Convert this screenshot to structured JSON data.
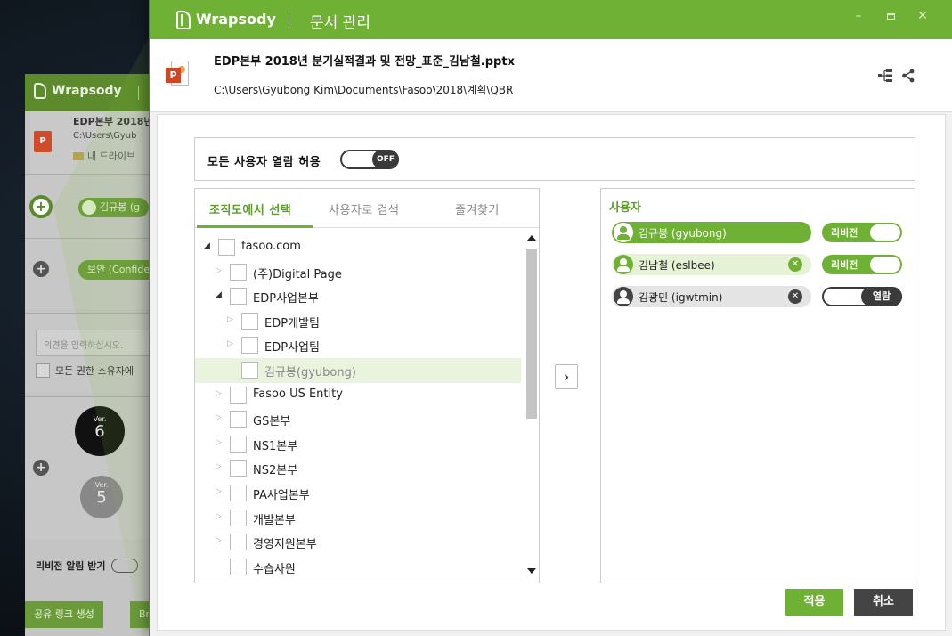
{
  "background_window": {
    "brand": "Wrapsody",
    "file_name": "EDP본부 2018년",
    "file_path": "C:\\Users\\Gyub",
    "folder": "내 드라이브",
    "chip_owner": "김규봉 (g",
    "chip_security": "보안 (Confide",
    "comment_placeholder": "의견을 입력하십시오.",
    "checkbox_label": "모든 권한 소유자에",
    "version_label": "Ver.",
    "version_6": "6",
    "version_5": "5",
    "revision_alert": "리비전 알림 받기",
    "share_link_button": "공유 링크 생성",
    "bra_button": "Bra"
  },
  "window": {
    "brand": "Wrapsody",
    "title": "문서 관리",
    "minimize": "–",
    "close": "✕"
  },
  "file": {
    "icon_letter": "P",
    "name": "EDP본부 2018년 분기실적결과 및 전망_표준_김남철.pptx",
    "path": "C:\\Users\\Gyubong Kim\\Documents\\Fasoo\\2018\\계획\\QBR"
  },
  "allow_all": {
    "label": "모든 사용자 열람 허용",
    "toggle_state": "OFF"
  },
  "tabs": [
    {
      "label": "조직도에서 선택",
      "active": true
    },
    {
      "label": "사용자로 검색",
      "active": false
    },
    {
      "label": "즐겨찾기",
      "active": false
    }
  ],
  "tree": [
    {
      "label": "fasoo.com",
      "depth": 0,
      "arrow": "◢",
      "open": true,
      "selected": false
    },
    {
      "label": "(주)Digital Page",
      "depth": 1,
      "arrow": "▷",
      "open": false,
      "selected": false
    },
    {
      "label": "EDP사업본부",
      "depth": 1,
      "arrow": "◢",
      "open": true,
      "selected": false
    },
    {
      "label": "EDP개발팀",
      "depth": 2,
      "arrow": "▷",
      "open": false,
      "selected": false
    },
    {
      "label": "EDP사업팀",
      "depth": 2,
      "arrow": "▷",
      "open": false,
      "selected": false
    },
    {
      "label": "김규봉(gyubong)",
      "depth": 2,
      "arrow": "",
      "open": false,
      "selected": true
    },
    {
      "label": "Fasoo US Entity",
      "depth": 1,
      "arrow": "▷",
      "open": false,
      "selected": false
    },
    {
      "label": "GS본부",
      "depth": 1,
      "arrow": "▷",
      "open": false,
      "selected": false
    },
    {
      "label": "NS1본부",
      "depth": 1,
      "arrow": "▷",
      "open": false,
      "selected": false
    },
    {
      "label": "NS2본부",
      "depth": 1,
      "arrow": "▷",
      "open": false,
      "selected": false
    },
    {
      "label": "PA사업본부",
      "depth": 1,
      "arrow": "▷",
      "open": false,
      "selected": false
    },
    {
      "label": "개발본부",
      "depth": 1,
      "arrow": "▷",
      "open": false,
      "selected": false
    },
    {
      "label": "경영지원본부",
      "depth": 1,
      "arrow": "▷",
      "open": false,
      "selected": false
    },
    {
      "label": "수습사원",
      "depth": 1,
      "arrow": "",
      "open": false,
      "selected": false
    }
  ],
  "move_button": "›",
  "users_panel": {
    "title": "사용자",
    "users": [
      {
        "name": "김규봉 (gyubong)",
        "style": "owner",
        "removable": false,
        "permission": "리비전",
        "perm_style": "green"
      },
      {
        "name": "김남철 (eslbee)",
        "style": "light",
        "removable": true,
        "permission": "리비전",
        "perm_style": "green"
      },
      {
        "name": "김광민 (igwtmin)",
        "style": "grey",
        "removable": true,
        "permission": "열람",
        "perm_style": "dark"
      }
    ],
    "remove_glyph": "✕"
  },
  "buttons": {
    "apply": "적용",
    "cancel": "취소"
  },
  "colors": {
    "accent": "#6fb134",
    "accent_dark": "#5d9e2a",
    "dark_button": "#444444"
  }
}
